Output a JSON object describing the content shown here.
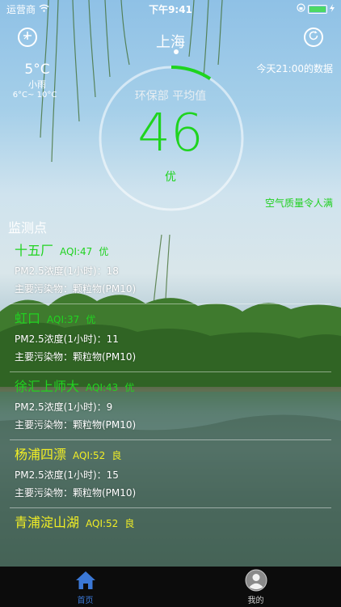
{
  "status": {
    "carrier": "运营商",
    "time": "下午9:41"
  },
  "header": {
    "city": "上海",
    "left_icon": "add-city-icon",
    "right_icon": "refresh-icon"
  },
  "weather": {
    "temp": "5°C",
    "condition": "小雨",
    "range": "6°C~ 10°C"
  },
  "data_time": "今天21:00的数据",
  "gauge": {
    "label": "环保部 平均值",
    "value": "46",
    "level": "优",
    "fraction": 0.092,
    "color": "#1fd41f"
  },
  "quality_note": "空气质量令人满",
  "section_title": "监测点",
  "stations": [
    {
      "name": "十五厂",
      "aqi": "AQI:47",
      "level": "优",
      "pm25": "PM2.5浓度(1小时)：18",
      "pollutant": "主要污染物：颗粒物(PM10)",
      "color": "green"
    },
    {
      "name": "虹口",
      "aqi": "AQI:37",
      "level": "优",
      "pm25": "PM2.5浓度(1小时)：11",
      "pollutant": "主要污染物：颗粒物(PM10)",
      "color": "green"
    },
    {
      "name": "徐汇上师大",
      "aqi": "AQI:43",
      "level": "优",
      "pm25": "PM2.5浓度(1小时)：9",
      "pollutant": "主要污染物：颗粒物(PM10)",
      "color": "green"
    },
    {
      "name": "杨浦四漂",
      "aqi": "AQI:52",
      "level": "良",
      "pm25": "PM2.5浓度(1小时)：15",
      "pollutant": "主要污染物：颗粒物(PM10)",
      "color": "yellow"
    },
    {
      "name": "青浦淀山湖",
      "aqi": "AQI:52",
      "level": "良",
      "pm25": "",
      "pollutant": "",
      "color": "yellow"
    }
  ],
  "tabs": [
    {
      "label": "首页",
      "icon": "home-icon",
      "active": true
    },
    {
      "label": "我的",
      "icon": "profile-icon",
      "active": false
    }
  ]
}
